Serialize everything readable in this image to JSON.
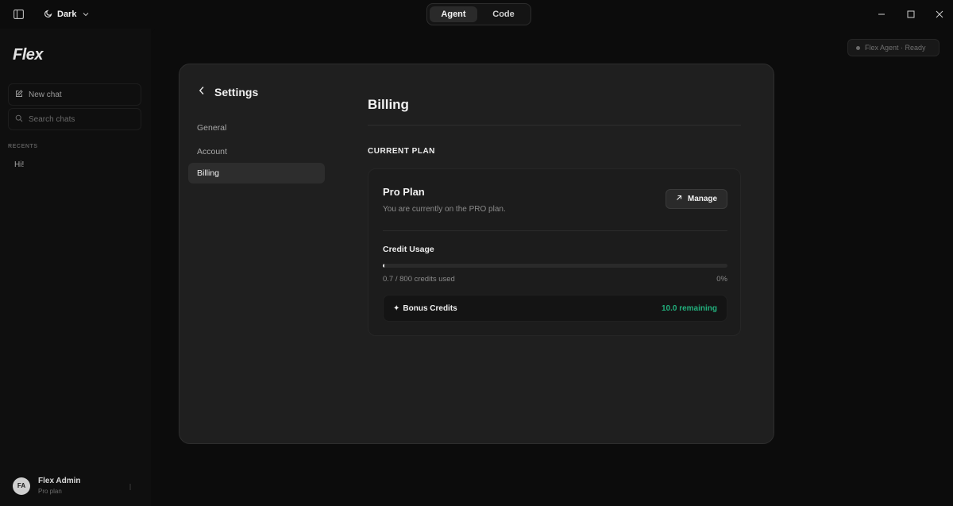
{
  "titlebar": {
    "theme_label": "Dark",
    "modes": [
      {
        "label": "Agent",
        "active": true
      },
      {
        "label": "Code",
        "active": false
      }
    ]
  },
  "sidebar": {
    "logo": "Flex",
    "new_chat": "New chat",
    "search_placeholder": "Search chats",
    "recents_label": "RECENTS",
    "recents": [
      "Hi!"
    ],
    "user": {
      "initials": "FA",
      "name": "Flex Admin",
      "plan": "Pro plan"
    }
  },
  "agent_status": "Flex Agent · Ready",
  "settings": {
    "title": "Settings",
    "nav": [
      "General",
      "Account",
      "Billing"
    ],
    "active_nav": "Billing"
  },
  "billing": {
    "heading": "Billing",
    "section": "CURRENT PLAN",
    "plan_name": "Pro Plan",
    "plan_desc": "You are currently on the PRO plan.",
    "manage_label": "Manage",
    "usage_label": "Credit Usage",
    "usage_text": "0.7 / 800 credits used",
    "usage_pct": "0%",
    "usage_fraction": 0.000875,
    "bonus_label": "Bonus Credits",
    "bonus_symbol": "✦",
    "bonus_remaining": "10.0 remaining"
  },
  "colors": {
    "accent_green": "#22b07d",
    "background": "#0c0c0c",
    "modal": "#1f1f1f"
  }
}
